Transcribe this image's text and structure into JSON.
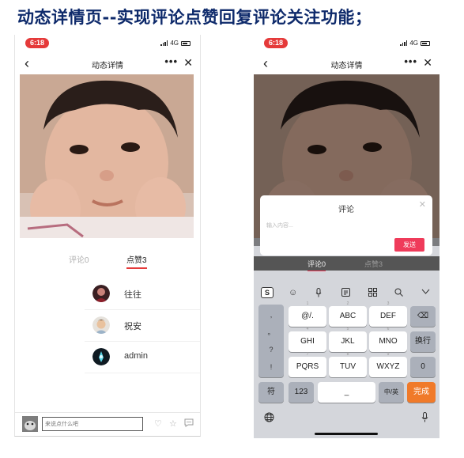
{
  "headline": "动态详情页--实现评论点赞回复评论关注功能；",
  "left_phone": {
    "status": {
      "time": "6:18",
      "network": "4G"
    },
    "nav": {
      "back": "‹",
      "title": "动态详情",
      "more": "•••",
      "close": "✕"
    },
    "tabs": {
      "comments": "评论0",
      "likes": "点赞3"
    },
    "likes": [
      {
        "name": "往往"
      },
      {
        "name": "祝安"
      },
      {
        "name": "admin"
      }
    ],
    "bottom": {
      "input_placeholder": "来说点什么吧"
    }
  },
  "right_phone": {
    "status": {
      "time": "6:18",
      "network": "4G"
    },
    "nav": {
      "back": "‹",
      "title": "动态详情",
      "more": "•••",
      "close": "✕"
    },
    "dialog": {
      "title": "评论",
      "close": "✕",
      "placeholder": "输入内容...",
      "send": "发送"
    },
    "tabs": {
      "comments": "评论0",
      "likes": "点赞3"
    },
    "keyboard": {
      "punct": [
        ",",
        "。",
        "?",
        "!"
      ],
      "row1": [
        {
          "label": "@/.",
          "sub": "1"
        },
        {
          "label": "ABC",
          "sub": "2"
        },
        {
          "label": "DEF",
          "sub": "3"
        }
      ],
      "row2": [
        {
          "label": "GHI",
          "sub": "4"
        },
        {
          "label": "JKL",
          "sub": "5"
        },
        {
          "label": "MNO",
          "sub": "6"
        }
      ],
      "row3": [
        {
          "label": "PQRS",
          "sub": "7"
        },
        {
          "label": "TUV",
          "sub": "8"
        },
        {
          "label": "WXYZ",
          "sub": "9"
        }
      ],
      "delete": "⌫",
      "newline": "换行",
      "zero": "0",
      "symbols": "符",
      "num": "123",
      "space": "_",
      "lang": "中/英",
      "done": "完成"
    }
  },
  "colors": {
    "accent_red": "#e53a3a",
    "send_pink": "#ef3b5a",
    "done_orange": "#f07a2a",
    "headline_blue": "#0e2a6b"
  }
}
